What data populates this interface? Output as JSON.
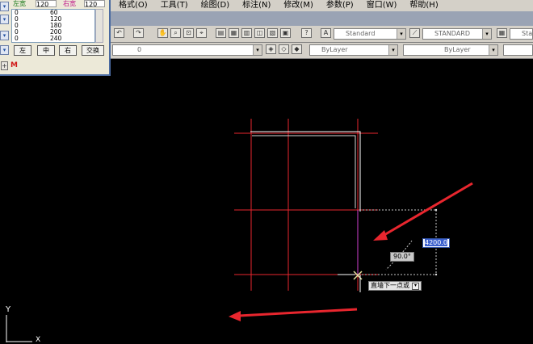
{
  "menu": [
    "格式(O)",
    "工具(T)",
    "绘图(D)",
    "标注(N)",
    "修改(M)",
    "参数(P)",
    "窗口(W)",
    "帮助(H)"
  ],
  "toolbar": {
    "text_style": "Standard",
    "dim_style": "STANDARD",
    "table_style": "Standard",
    "layer_value": "0",
    "color": "ByLayer",
    "linetype": "ByLayer"
  },
  "palette": {
    "left_label": "左宽",
    "left_value": "120",
    "right_label": "右宽",
    "right_value": "120",
    "rows": [
      {
        "a": "0",
        "b": "60"
      },
      {
        "a": "0",
        "b": "120"
      },
      {
        "a": "0",
        "b": "180"
      },
      {
        "a": "0",
        "b": "200"
      },
      {
        "a": "0",
        "b": "240"
      }
    ],
    "btn_left": "左",
    "btn_mid": "中",
    "btn_right": "右",
    "btn_swap": "交换"
  },
  "m_marker": "M",
  "dynamic_input": {
    "distance": "4200.0",
    "angle": "90.0°",
    "prompt": "直墙下一点或"
  },
  "ucs": {
    "y": "Y",
    "x": "X"
  },
  "colors": {
    "grid": "#e8262e",
    "wall": "#ffffff",
    "dotted": "#c8c8c8",
    "arrow": "#e8262e",
    "cursor": "#e6e2a0"
  }
}
